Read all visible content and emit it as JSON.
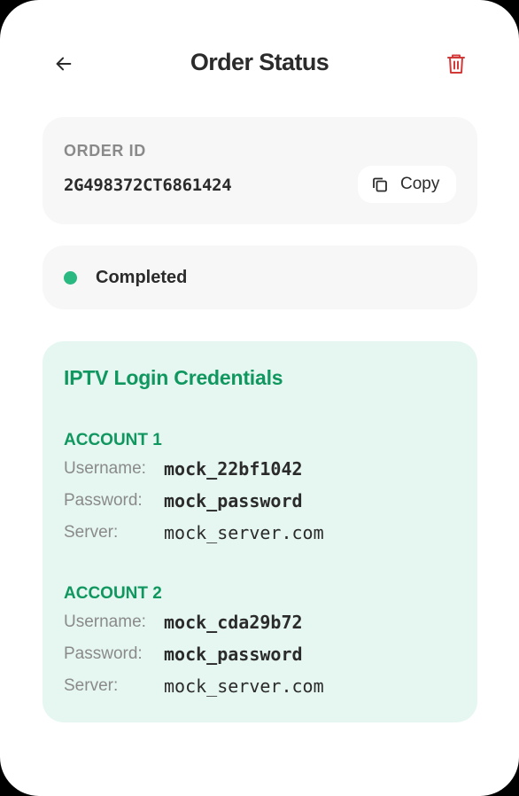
{
  "header": {
    "title": "Order Status",
    "back_icon": "arrow-left-icon",
    "delete_icon": "trash-icon"
  },
  "order": {
    "label": "ORDER ID",
    "id": "2G498372CT6861424",
    "copy_label": "Copy",
    "copy_icon": "copy-icon"
  },
  "status": {
    "text": "Completed",
    "color": "#2bb982"
  },
  "credentials": {
    "title": "IPTV Login Credentials",
    "accounts": [
      {
        "heading": "ACCOUNT 1",
        "username_label": "Username:",
        "username": "mock_22bf1042",
        "password_label": "Password:",
        "password": "mock_password",
        "server_label": "Server:",
        "server": "mock_server.com"
      },
      {
        "heading": "ACCOUNT 2",
        "username_label": "Username:",
        "username": "mock_cda29b72",
        "password_label": "Password:",
        "password": "mock_password",
        "server_label": "Server:",
        "server": "mock_server.com"
      }
    ]
  },
  "colors": {
    "accent_green": "#10975f",
    "danger_red": "#d23a3a",
    "card_bg": "#f7f7f7",
    "cred_bg": "#e5f7f0"
  }
}
